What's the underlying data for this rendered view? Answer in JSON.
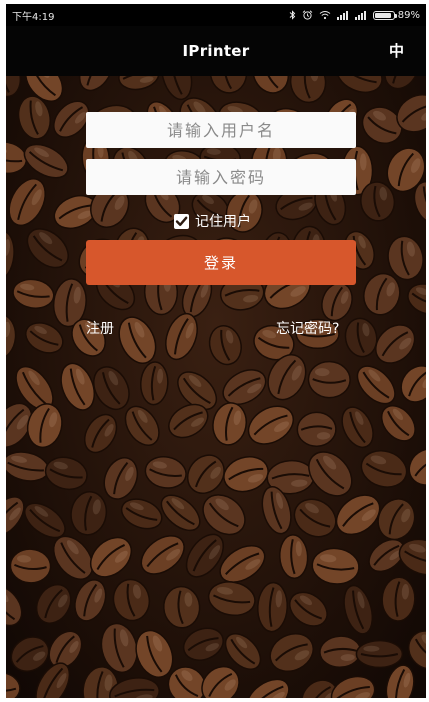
{
  "status_bar": {
    "time": "下午4:19",
    "battery": "89%",
    "battery_level": 0.89
  },
  "app_bar": {
    "title": "IPrinter",
    "language_toggle": "中"
  },
  "login_form": {
    "username_placeholder": "请输入用户名",
    "password_placeholder": "请输入密码",
    "remember_label": "记住用户",
    "remember_checked": true,
    "login_button": "登录"
  },
  "links": {
    "register": "注册",
    "forgot_password": "忘记密码?"
  },
  "colors": {
    "accent": "#d7572c",
    "app_bar_bg": "#050505"
  }
}
